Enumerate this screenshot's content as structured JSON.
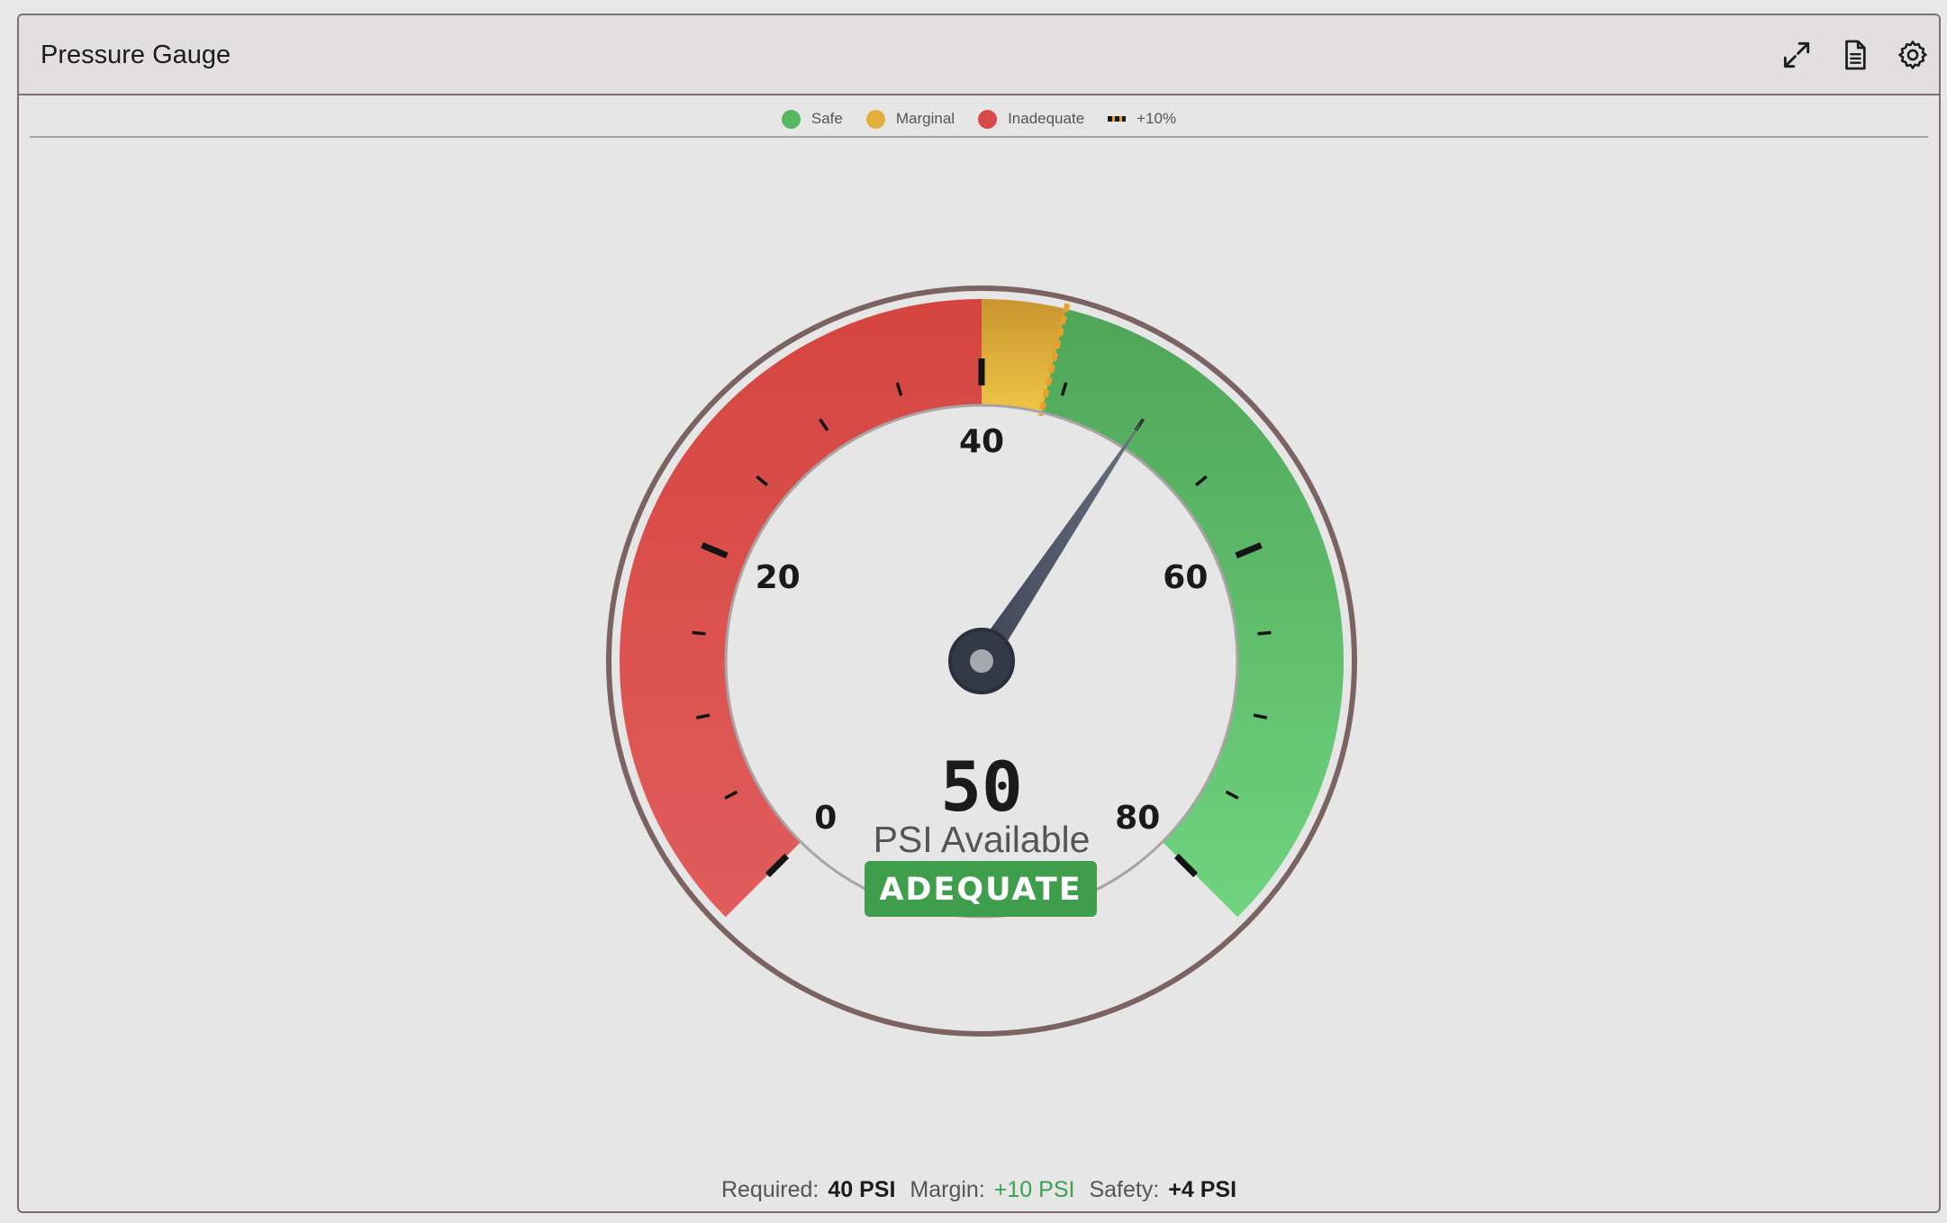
{
  "panel": {
    "title": "Pressure Gauge",
    "actions": [
      {
        "name": "expand",
        "icon": "expand-icon"
      },
      {
        "name": "report",
        "icon": "document-icon"
      },
      {
        "name": "settings",
        "icon": "gear-icon"
      }
    ]
  },
  "legend": [
    {
      "label": "Safe",
      "color": "#55b861"
    },
    {
      "label": "Marginal",
      "color": "#e2b03a"
    },
    {
      "label": "Inadequate",
      "color": "#d9484a"
    },
    {
      "label": "+10%",
      "style": "dashed",
      "color": "#e8a02e"
    }
  ],
  "gauge": {
    "min": 0,
    "max": 80,
    "value": 50,
    "unit_label": "PSI Available",
    "status": "ADEQUATE",
    "status_color": "#3e9e4c",
    "major_ticks": [
      0,
      20,
      40,
      60,
      80
    ],
    "minor_step": 5,
    "zones": [
      {
        "name": "Inadequate",
        "from": 0,
        "to": 40,
        "color": "#d9484a"
      },
      {
        "name": "Marginal",
        "from": 40,
        "to": 44,
        "color": "#e2b03a"
      },
      {
        "name": "Safe",
        "from": 44,
        "to": 80,
        "color": "#55b861"
      }
    ],
    "threshold_plus10": 44
  },
  "footer": {
    "required_label": "Required:",
    "required_value": "40 PSI",
    "margin_label": "Margin:",
    "margin_value": "+10 PSI",
    "safety_label": "Safety:",
    "safety_value": "+4 PSI"
  }
}
